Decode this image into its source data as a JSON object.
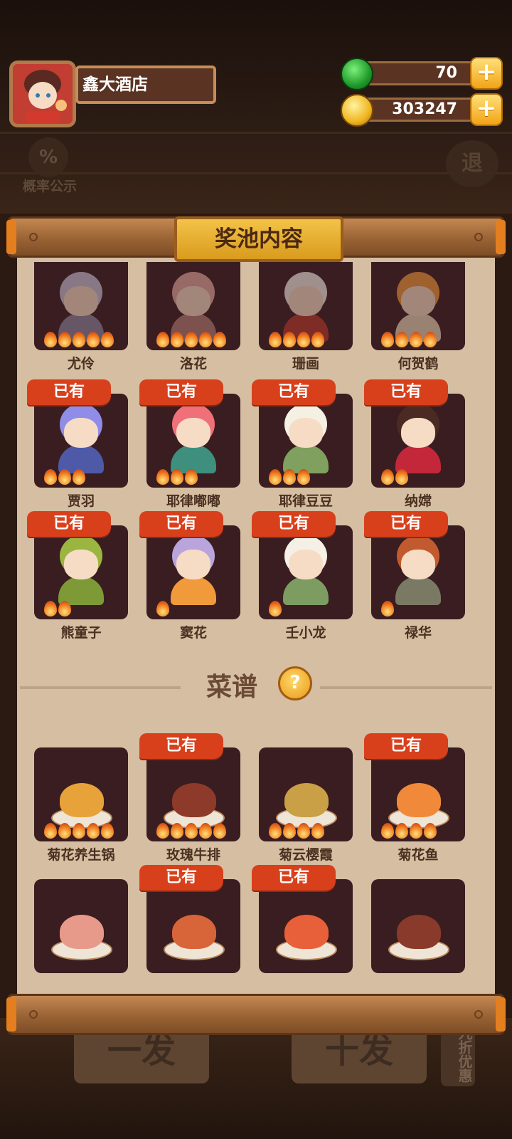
{
  "header": {
    "restaurant_name": "鑫大酒店",
    "jade": "70",
    "coins": "303247",
    "plus": "+"
  },
  "side": {
    "prob_icon": "%",
    "prob_label": "概率公示",
    "exit_label": "退"
  },
  "panel": {
    "title": "奖池内容",
    "owned_badge": "已有",
    "recipes_title": "菜谱",
    "help": "?"
  },
  "characters": [
    {
      "name": "尤伶",
      "stars": 5,
      "owned": false,
      "hair": "#c9c3d8",
      "body": "#8b86a0"
    },
    {
      "name": "洛花",
      "stars": 5,
      "owned": false,
      "hair": "#e3a9a0",
      "body": "#b57e74"
    },
    {
      "name": "珊画",
      "stars": 4,
      "owned": false,
      "hair": "#f3ede6",
      "body": "#b83a2e"
    },
    {
      "name": "何贺鹤",
      "stars": 4,
      "owned": false,
      "hair": "#f29a3a",
      "body": "#e8d6b6"
    },
    {
      "name": "贾羽",
      "stars": 3,
      "owned": true,
      "hair": "#8f8de8",
      "body": "#4e5aa8"
    },
    {
      "name": "耶律嘟嘟",
      "stars": 3,
      "owned": true,
      "hair": "#f0707a",
      "body": "#3e8f7e"
    },
    {
      "name": "耶律豆豆",
      "stars": 3,
      "owned": true,
      "hair": "#f4f0e4",
      "body": "#7fa05e"
    },
    {
      "name": "纳嫦",
      "stars": 2,
      "owned": true,
      "hair": "#4a2a22",
      "body": "#c3283a"
    },
    {
      "name": "熊童子",
      "stars": 2,
      "owned": true,
      "hair": "#9bb640",
      "body": "#7e9a36"
    },
    {
      "name": "窦花",
      "stars": 1,
      "owned": true,
      "hair": "#b9a4dc",
      "body": "#f09a3c"
    },
    {
      "name": "壬小龙",
      "stars": 1,
      "owned": true,
      "hair": "#f4f0e6",
      "body": "#7c9c62"
    },
    {
      "name": "禄华",
      "stars": 1,
      "owned": true,
      "hair": "#c15a2e",
      "body": "#7a7a64"
    }
  ],
  "recipes": [
    {
      "name": "菊花养生锅",
      "stars": 5,
      "owned": false,
      "food": "#e8a23a"
    },
    {
      "name": "玫瑰牛排",
      "stars": 5,
      "owned": true,
      "food": "#8e3a2a"
    },
    {
      "name": "菊云樱霞",
      "stars": 4,
      "owned": false,
      "food": "#c9a046"
    },
    {
      "name": "菊花鱼",
      "stars": 4,
      "owned": true,
      "food": "#f08a3a"
    },
    {
      "name": "",
      "stars": 0,
      "owned": false,
      "food": "#e89a8a"
    },
    {
      "name": "",
      "stars": 0,
      "owned": true,
      "food": "#d8643a"
    },
    {
      "name": "",
      "stars": 0,
      "owned": true,
      "food": "#e8603a"
    },
    {
      "name": "",
      "stars": 0,
      "owned": false,
      "food": "#8a3a2a"
    }
  ],
  "bottom": {
    "draw_one": "一发",
    "draw_ten": "十发",
    "discount": "九折优惠"
  }
}
